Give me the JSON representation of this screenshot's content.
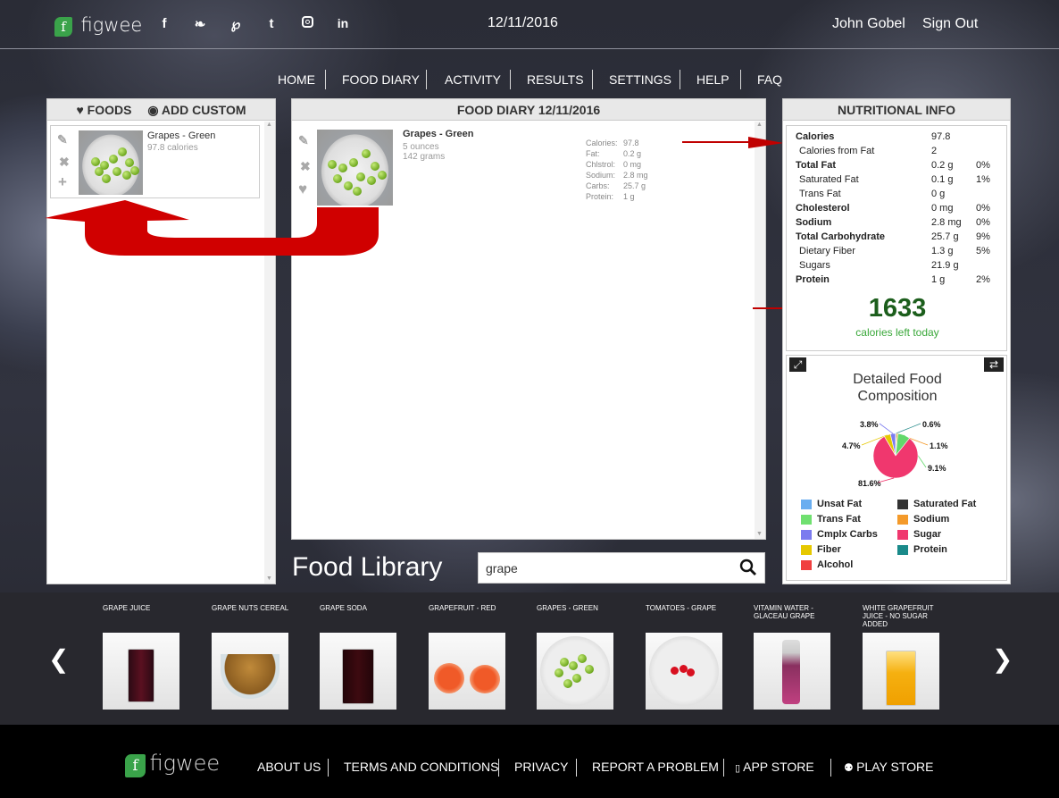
{
  "header": {
    "brand": "figwee",
    "brand_letter": "f",
    "social_icons": [
      "facebook-icon",
      "twitter-icon",
      "pinterest-icon",
      "tumblr-icon",
      "instagram-icon",
      "linkedin-icon"
    ],
    "date": "12/11/2016",
    "user_name": "John Gobel",
    "sign_out": "Sign Out"
  },
  "nav": [
    "HOME",
    "FOOD DIARY",
    "ACTIVITY",
    "RESULTS",
    "SETTINGS",
    "HELP",
    "FAQ"
  ],
  "foods_panel": {
    "tab_foods": "FOODS",
    "tab_custom": "ADD CUSTOM",
    "item": {
      "name": "Grapes - Green",
      "calories": "97.8 calories"
    }
  },
  "diary_panel": {
    "title": "FOOD DIARY 12/11/2016",
    "item": {
      "name": "Grapes - Green",
      "amount1": "5 ounces",
      "amount2": "142 grams",
      "labels": [
        "Calories:",
        "Fat:",
        "Chlstrol:",
        "Sodium:",
        "Carbs:",
        "Protein:"
      ],
      "values": [
        "97.8",
        "0.2 g",
        "0 mg",
        "2.8 mg",
        "25.7 g",
        "1 g"
      ]
    }
  },
  "nutrition": {
    "title": "NUTRITIONAL INFO",
    "rows": [
      {
        "label": "Calories",
        "value": "97.8",
        "pct": ""
      },
      {
        "label": "Calories from Fat",
        "value": "2",
        "pct": ""
      },
      {
        "label": "Total Fat",
        "value": "0.2 g",
        "pct": "0%"
      },
      {
        "label": "Saturated Fat",
        "value": "0.1 g",
        "pct": "1%"
      },
      {
        "label": "Trans Fat",
        "value": "0 g",
        "pct": ""
      },
      {
        "label": "Cholesterol",
        "value": "0 mg",
        "pct": "0%"
      },
      {
        "label": "Sodium",
        "value": "2.8 mg",
        "pct": "0%"
      },
      {
        "label": "Total Carbohydrate",
        "value": "25.7 g",
        "pct": "9%"
      },
      {
        "label": "Dietary Fiber",
        "value": "1.3 g",
        "pct": "5%"
      },
      {
        "label": "Sugars",
        "value": "21.9 g",
        "pct": ""
      },
      {
        "label": "Protein",
        "value": "1 g",
        "pct": "2%"
      }
    ],
    "calories_left": "1633",
    "calories_left_label": "calories left today"
  },
  "composition": {
    "title_line1": "Detailed Food",
    "title_line2": "Composition",
    "slices": [
      {
        "label": "81.6%",
        "value": 81.6,
        "color": "#f0376e"
      },
      {
        "label": "4.7%",
        "value": 4.7,
        "color": "#e6c800"
      },
      {
        "label": "3.8%",
        "value": 3.8,
        "color": "#7b7bef"
      },
      {
        "label": "0.6%",
        "value": 0.6,
        "color": "#2f8f8f"
      },
      {
        "label": "1.1%",
        "value": 1.1,
        "color": "#f49a2a"
      },
      {
        "label": "9.1%",
        "value": 9.1,
        "color": "#62d86b"
      }
    ],
    "legend": [
      {
        "label": "Unsat Fat",
        "color": "#6aaef0"
      },
      {
        "label": "Saturated Fat",
        "color": "#333333"
      },
      {
        "label": "Trans Fat",
        "color": "#70e070"
      },
      {
        "label": "Sodium",
        "color": "#f49a2a"
      },
      {
        "label": "Cmplx Carbs",
        "color": "#7b7bef"
      },
      {
        "label": "Sugar",
        "color": "#f0376e"
      },
      {
        "label": "Fiber",
        "color": "#e6c800"
      },
      {
        "label": "Protein",
        "color": "#1a8a8a"
      },
      {
        "label": "Alcohol",
        "color": "#f04040"
      }
    ]
  },
  "library": {
    "title": "Food Library",
    "search_value": "grape",
    "items": [
      "GRAPE JUICE",
      "GRAPE NUTS CEREAL",
      "GRAPE SODA",
      "GRAPEFRUIT - RED",
      "GRAPES - GREEN",
      "TOMATOES - GRAPE",
      "VITAMIN WATER - GLACEAU GRAPE",
      "WHITE GRAPEFRUIT JUICE - NO SUGAR ADDED"
    ]
  },
  "footer": {
    "brand": "figwee",
    "links": [
      "ABOUT US",
      "TERMS AND CONDITIONS",
      "PRIVACY",
      "REPORT A PROBLEM",
      "APP STORE",
      "PLAY STORE"
    ]
  }
}
